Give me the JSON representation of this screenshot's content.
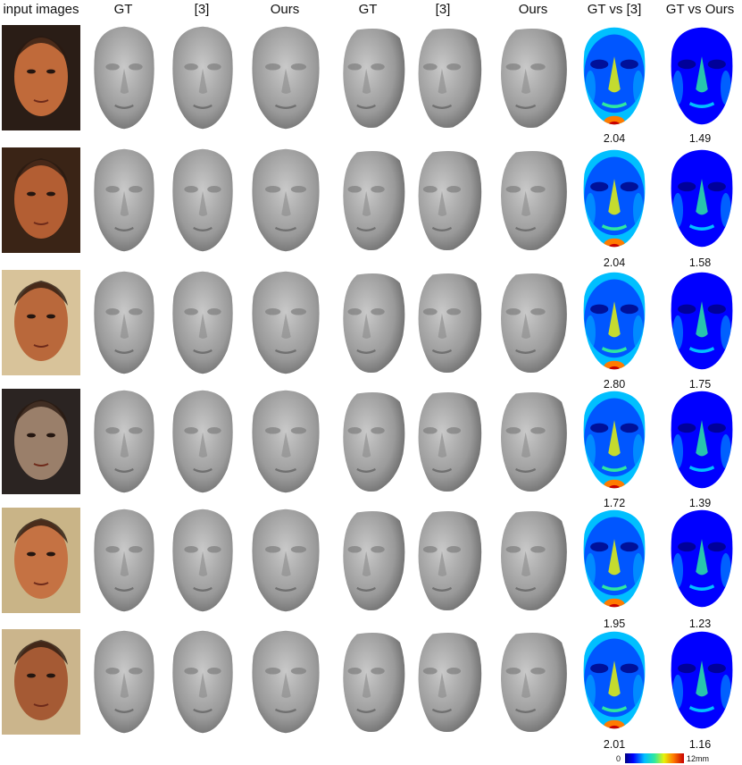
{
  "headers": [
    "input images",
    "GT",
    "[3]",
    "Ours",
    "GT",
    "[3]",
    "Ours",
    "GT vs [3]",
    "GT vs Ours"
  ],
  "rows": [
    {
      "skin": "#c06a3a",
      "bg": "#2a1d16",
      "err_ref": "2.04",
      "err_ours": "1.49"
    },
    {
      "skin": "#b35e33",
      "bg": "#3a2416",
      "err_ref": "2.04",
      "err_ours": "1.58"
    },
    {
      "skin": "#b9683b",
      "bg": "#d8c39a",
      "err_ref": "2.80",
      "err_ours": "1.75"
    },
    {
      "skin": "#9a7f6a",
      "bg": "#2b2422",
      "err_ref": "1.72",
      "err_ours": "1.39"
    },
    {
      "skin": "#c57243",
      "bg": "#c9b487",
      "err_ref": "1.95",
      "err_ours": "1.23"
    },
    {
      "skin": "#a55a34",
      "bg": "#cbb58c",
      "err_ref": "2.01",
      "err_ours": "1.16"
    }
  ],
  "colorbar": {
    "min_label": "0",
    "max_label": "12mm",
    "colors": [
      "#00007f",
      "#0000ff",
      "#00bfff",
      "#2ee8a0",
      "#e6f20a",
      "#ff7b00",
      "#c80000"
    ]
  }
}
